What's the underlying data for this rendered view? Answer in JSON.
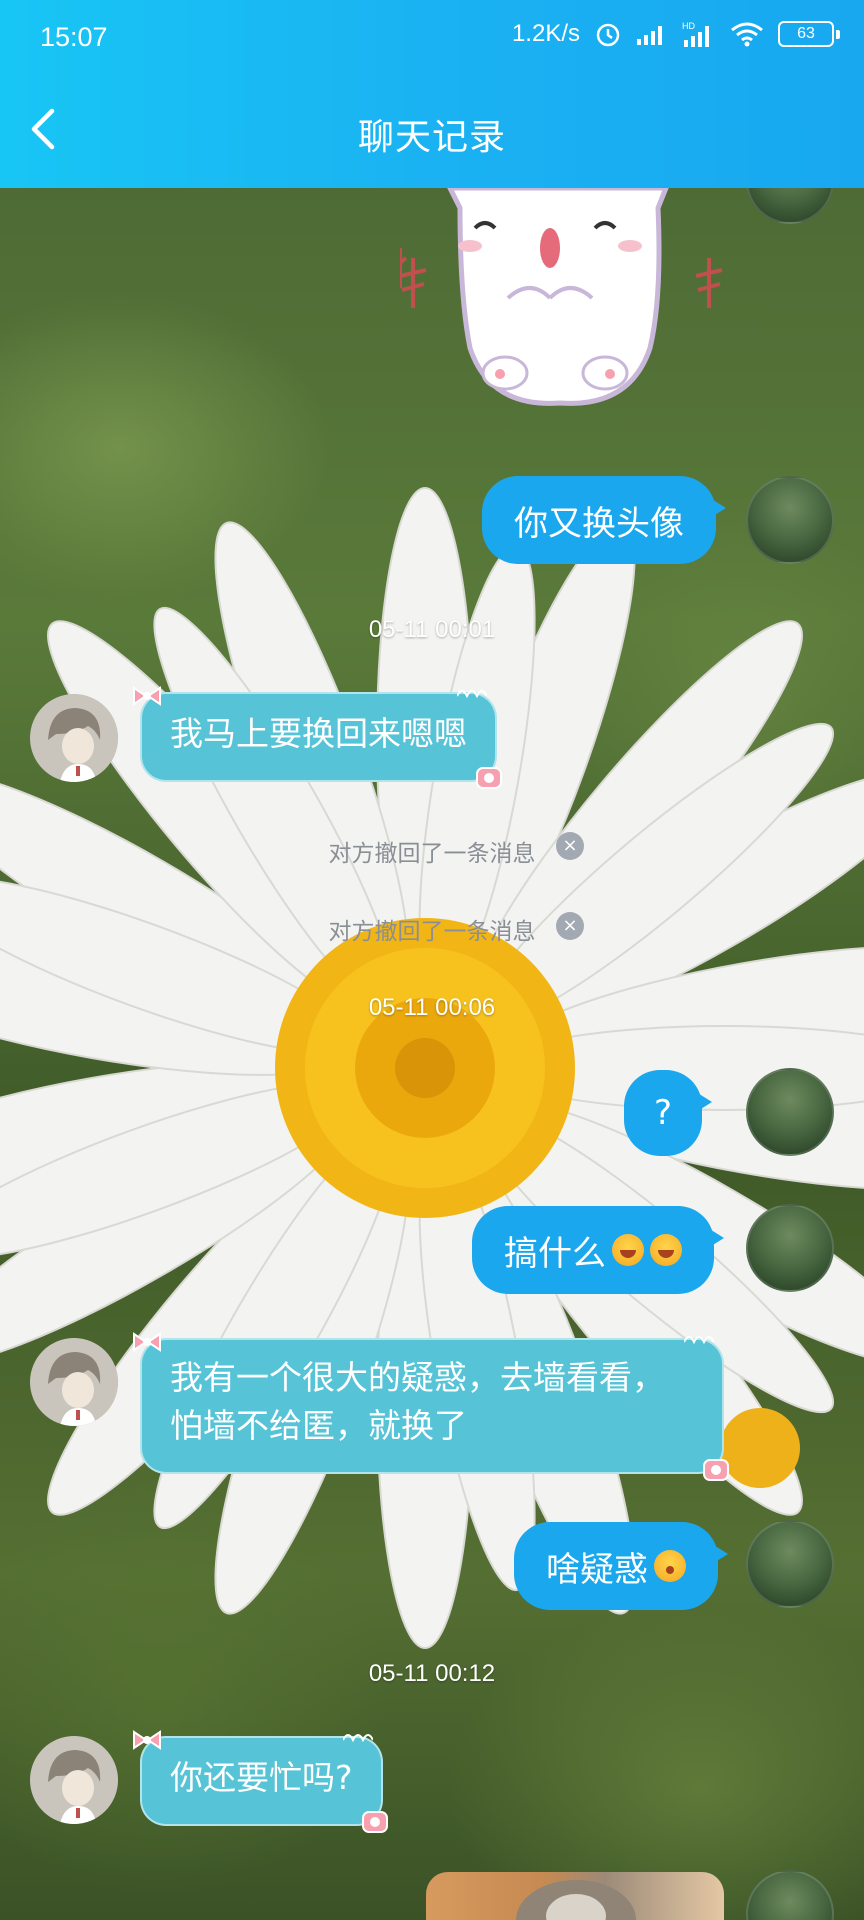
{
  "status_bar": {
    "time": "15:07",
    "net_speed": "1.2K/s",
    "battery": "63"
  },
  "header": {
    "title": "聊天记录"
  },
  "messages": {
    "m1": "你又换头像",
    "ts1": "05-11 00:01",
    "m2": "我马上要换回来嗯嗯",
    "recall1": "对方撤回了一条消息",
    "recall2": "对方撤回了一条消息",
    "ts2": "05-11 00:06",
    "m3": "?",
    "m4": "搞什么",
    "m5": "我有一个很大的疑惑，去墙看看，怕墙不给匿，就换了",
    "m6": "啥疑惑",
    "ts3": "05-11 00:12",
    "m7": "你还要忙吗?"
  },
  "colors": {
    "header": "#1ab2f2",
    "mine_bubble": "#1aa7ee",
    "their_bubble": "#56c3d6"
  },
  "icons": [
    "back-icon",
    "alarm-icon",
    "signal-icon",
    "wifi-icon",
    "battery-icon",
    "laugh-emoji-icon",
    "surprised-emoji-icon",
    "sticker-cat-icon"
  ]
}
